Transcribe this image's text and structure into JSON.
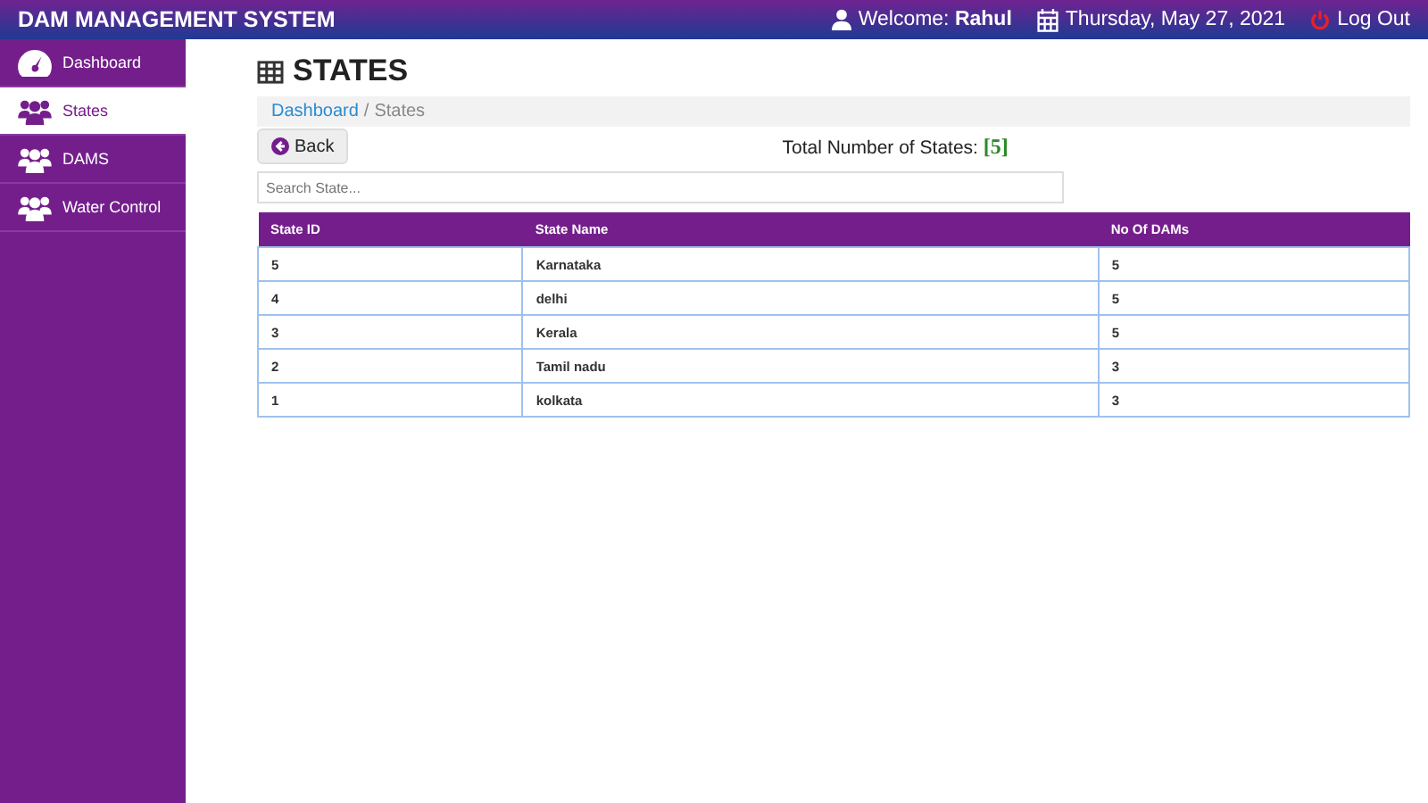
{
  "header": {
    "title": "DAM MANAGEMENT SYSTEM",
    "welcome": "Welcome: **Rahul**",
    "date": "Thursday, May 27, 2021",
    "logout": "Log Out"
  },
  "sidebar": {
    "items": [
      {
        "label": "Dashboard",
        "kind": "dashboard",
        "selected": false
      },
      {
        "label": "States",
        "kind": "section",
        "selected": true
      },
      {
        "label": "DAMS",
        "kind": "section",
        "selected": false
      },
      {
        "label": "Water Control",
        "kind": "section",
        "selected": false
      }
    ]
  },
  "page": {
    "title": "STATES",
    "breadcrumb": {
      "link": "Dashboard",
      "separator": "/",
      "current": "States"
    },
    "back": "Back",
    "total_label": "Total Number of States:",
    "total_value": "[5]",
    "search": {
      "placeholder": "Search State..."
    }
  },
  "table": {
    "columns": [
      "State ID",
      "State Name",
      "No Of DAMs"
    ],
    "rows": [
      [
        "5",
        "Karnataka",
        "5"
      ],
      [
        "4",
        "delhi",
        "5"
      ],
      [
        "3",
        "Kerala",
        "5"
      ],
      [
        "2",
        "Tamil nadu",
        "3"
      ],
      [
        "1",
        "kolkata",
        "3"
      ]
    ]
  }
}
